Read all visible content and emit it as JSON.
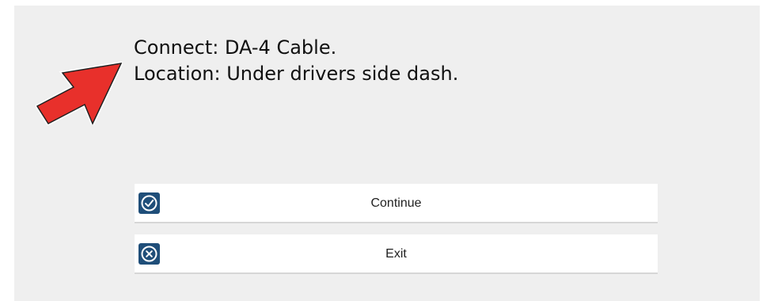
{
  "message": {
    "line1": "Connect: DA-4 Cable.",
    "line2": "Location: Under drivers side dash."
  },
  "buttons": {
    "continue": {
      "label": "Continue",
      "icon": "check-circle-icon"
    },
    "exit": {
      "label": "Exit",
      "icon": "close-circle-icon"
    }
  },
  "colors": {
    "panel": "#efefef",
    "arrow": "#e8302b",
    "icon_bg": "#1f4e79"
  }
}
